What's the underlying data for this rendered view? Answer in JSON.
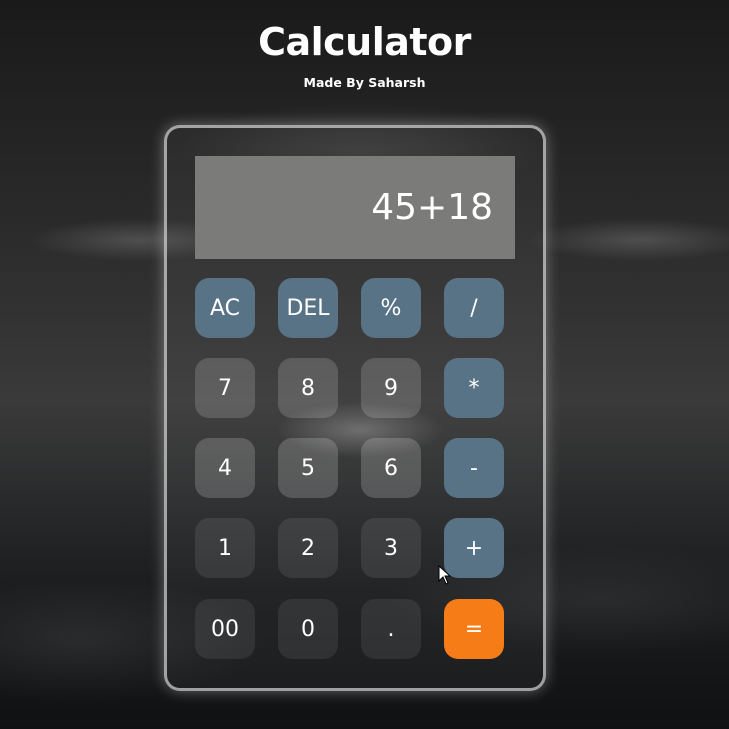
{
  "header": {
    "title": "Calculator",
    "subtitle": "Made By Saharsh"
  },
  "display": {
    "value": "45+18"
  },
  "keys": {
    "ac": "AC",
    "del": "DEL",
    "percent": "%",
    "divide": "/",
    "seven": "7",
    "eight": "8",
    "nine": "9",
    "multiply": "*",
    "four": "4",
    "five": "5",
    "six": "6",
    "minus": "-",
    "one": "1",
    "two": "2",
    "three": "3",
    "plus": "+",
    "double_zero": "00",
    "zero": "0",
    "dot": ".",
    "equals": "="
  },
  "colors": {
    "operator_key": "#587286",
    "equals_key": "#f57c16",
    "display_bg": "#7b7b79"
  },
  "icons": {
    "cursor": "mouse-pointer-icon"
  }
}
